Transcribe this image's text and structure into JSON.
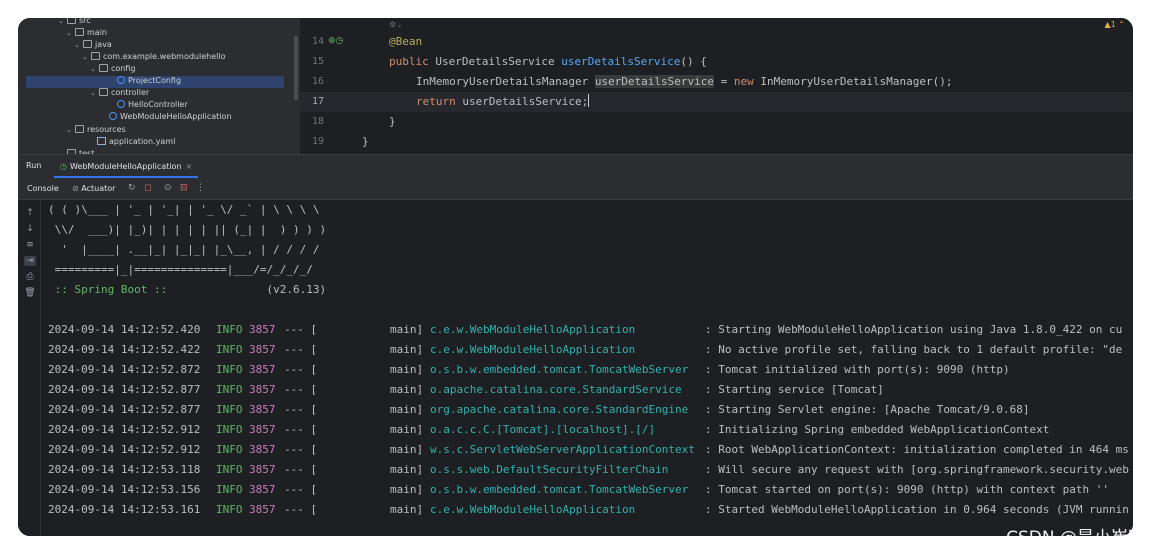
{
  "project_tree": {
    "items": [
      {
        "chev": "⌄",
        "label": "src",
        "indent": 3,
        "icon": "folder-icon"
      },
      {
        "chev": "⌄",
        "label": "main",
        "indent": 3,
        "icon": "folder-icon"
      },
      {
        "chev": "⌄",
        "label": "java",
        "indent": 3,
        "icon": "folder-icon"
      },
      {
        "chev": "⌄",
        "label": "com.example.webmodulehello",
        "indent": 3,
        "icon": "package-icon"
      },
      {
        "chev": "⌄",
        "label": "config",
        "indent": 3,
        "icon": "package-icon"
      },
      {
        "chev": "",
        "label": "ProjectConfig",
        "indent": 3,
        "icon": "class-icon"
      },
      {
        "chev": "⌄",
        "label": "controller",
        "indent": 3,
        "icon": "package-icon"
      },
      {
        "chev": "",
        "label": "HelloController",
        "indent": 3,
        "icon": "class-icon"
      },
      {
        "chev": "",
        "label": "WebModuleHelloApplication",
        "indent": 3,
        "icon": "class-icon"
      },
      {
        "chev": "⌄",
        "label": "resources",
        "indent": 3,
        "icon": "folder-icon"
      },
      {
        "chev": "",
        "label": "application.yaml",
        "indent": 3,
        "icon": "yaml-icon"
      },
      {
        "chev": "⌄",
        "label": "test",
        "indent": 3,
        "icon": "folder-icon"
      }
    ]
  },
  "editor": {
    "line_numbers": [
      "14",
      "15",
      "16",
      "17",
      "18",
      "19"
    ],
    "lines": {
      "l14": "@Bean",
      "l15_kw": "public",
      "l15_type": " UserDetailsService ",
      "l15_fn": "userDetailsService",
      "l15_rest": "() {",
      "l16_type": "InMemoryUserDetailsManager ",
      "l16_var": "userDetailsService",
      "l16_eq": " = ",
      "l16_kw": "new",
      "l16_rest": " InMemoryUserDetailsManager();",
      "l17_kw": "return",
      "l17_rest": " userDetailsService;",
      "l18": "}",
      "l19": "}"
    },
    "warning_badge": "▲1 ⌃"
  },
  "run_panel": {
    "run_label": "Run",
    "tab_label": "WebModuleHelloApplication",
    "tab_close": "×",
    "console_label": "Console",
    "actuator_label": "Actuator"
  },
  "console": {
    "banner": [
      "( ( )\\___ | '_ | '_| | '_ \\/ _` | \\ \\ \\ \\",
      " \\\\/  ___)| |_)| | | | | || (_| |  ) ) ) )",
      "  '  |____| .__|_| |_|_| |_\\__, | / / / /",
      " =========|_|==============|___/=/_/_/_/"
    ],
    "spring_label": " :: Spring Boot :: ",
    "spring_version": "              (v2.6.13)",
    "logs": [
      {
        "ts": "2024-09-14 14:12:52.420",
        "level": "INFO",
        "pid": "3857",
        "sep": "--- [",
        "thread": "main]",
        "logger": "c.e.w.WebModuleHelloApplication",
        "msg": ": Starting WebModuleHelloApplication using Java 1.8.0_422 on cu"
      },
      {
        "ts": "2024-09-14 14:12:52.422",
        "level": "INFO",
        "pid": "3857",
        "sep": "--- [",
        "thread": "main]",
        "logger": "c.e.w.WebModuleHelloApplication",
        "msg": ": No active profile set, falling back to 1 default profile: \"de"
      },
      {
        "ts": "2024-09-14 14:12:52.872",
        "level": "INFO",
        "pid": "3857",
        "sep": "--- [",
        "thread": "main]",
        "logger": "o.s.b.w.embedded.tomcat.TomcatWebServer",
        "msg": ": Tomcat initialized with port(s): 9090 (http)"
      },
      {
        "ts": "2024-09-14 14:12:52.877",
        "level": "INFO",
        "pid": "3857",
        "sep": "--- [",
        "thread": "main]",
        "logger": "o.apache.catalina.core.StandardService",
        "msg": ": Starting service [Tomcat]"
      },
      {
        "ts": "2024-09-14 14:12:52.877",
        "level": "INFO",
        "pid": "3857",
        "sep": "--- [",
        "thread": "main]",
        "logger": "org.apache.catalina.core.StandardEngine",
        "msg": ": Starting Servlet engine: [Apache Tomcat/9.0.68]"
      },
      {
        "ts": "2024-09-14 14:12:52.912",
        "level": "INFO",
        "pid": "3857",
        "sep": "--- [",
        "thread": "main]",
        "logger": "o.a.c.c.C.[Tomcat].[localhost].[/]",
        "msg": ": Initializing Spring embedded WebApplicationContext"
      },
      {
        "ts": "2024-09-14 14:12:52.912",
        "level": "INFO",
        "pid": "3857",
        "sep": "--- [",
        "thread": "main]",
        "logger": "w.s.c.ServletWebServerApplicationContext",
        "msg": ": Root WebApplicationContext: initialization completed in 464 ms"
      },
      {
        "ts": "2024-09-14 14:12:53.118",
        "level": "INFO",
        "pid": "3857",
        "sep": "--- [",
        "thread": "main]",
        "logger": "o.s.s.web.DefaultSecurityFilterChain",
        "msg": ": Will secure any request with [org.springframework.security.web"
      },
      {
        "ts": "2024-09-14 14:12:53.156",
        "level": "INFO",
        "pid": "3857",
        "sep": "--- [",
        "thread": "main]",
        "logger": "o.s.b.w.embedded.tomcat.TomcatWebServer",
        "msg": ": Tomcat started on port(s): 9090 (http) with context path ''"
      },
      {
        "ts": "2024-09-14 14:12:53.161",
        "level": "INFO",
        "pid": "3857",
        "sep": "--- [",
        "thread": "main]",
        "logger": "c.e.w.WebModuleHelloApplication",
        "msg": ": Started WebModuleHelloApplication in 0.964 seconds (JVM runnin"
      }
    ]
  },
  "watermark": "CSDN @是小崔啊"
}
